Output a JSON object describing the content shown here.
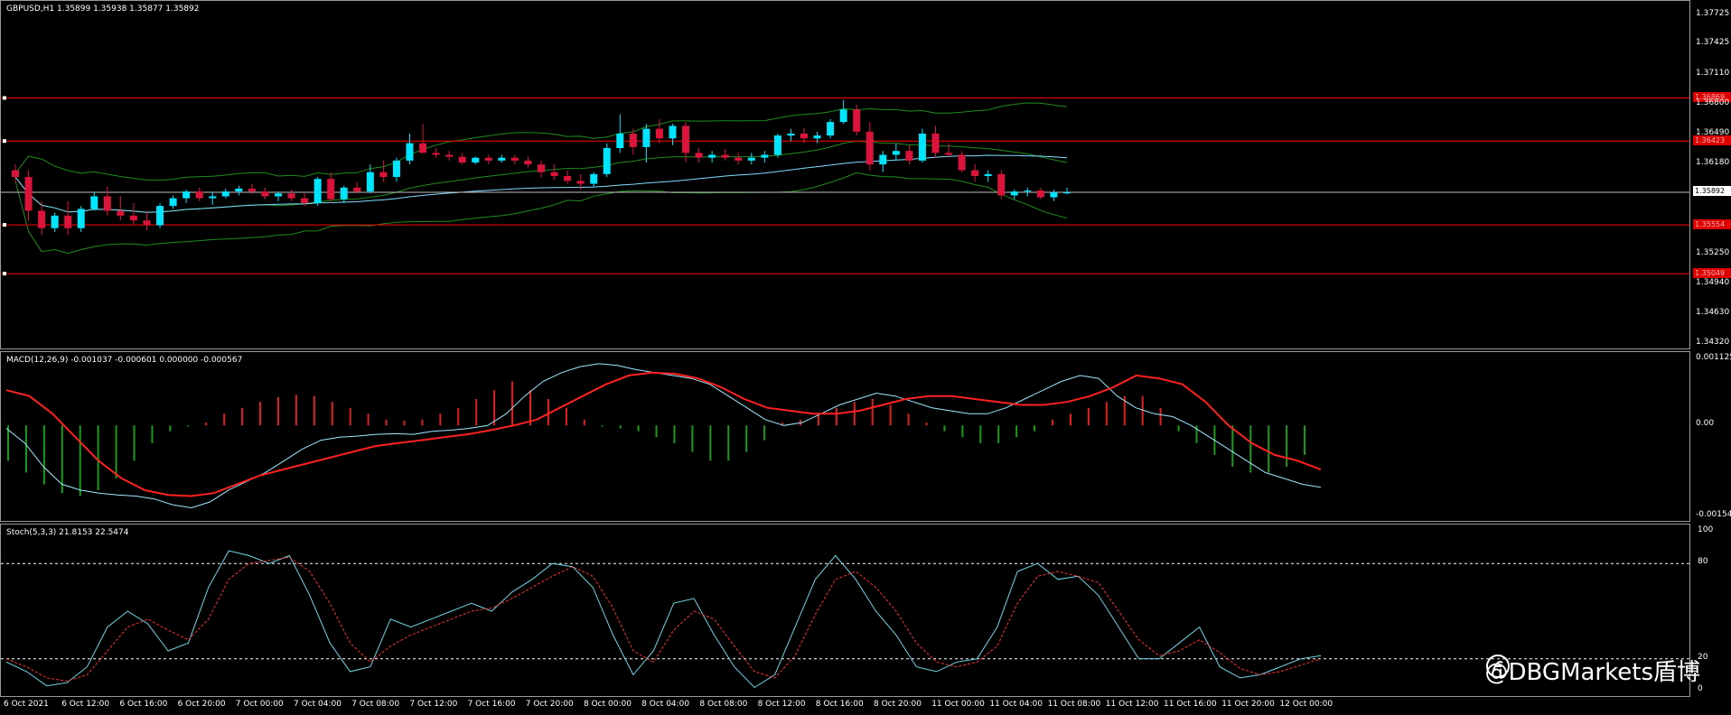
{
  "panels": {
    "price": {
      "title": "GBPUSD,H1  1.35899 1.35938 1.35877 1.35892",
      "yticks": [
        "1.37725",
        "1.37425",
        "1.37110",
        "1.36800",
        "1.36490",
        "1.36180",
        "1.35892",
        "1.35250",
        "1.34940",
        "1.34630",
        "1.34320"
      ],
      "hlines": [
        {
          "label": "1.36869"
        },
        {
          "label": "1.36423"
        },
        {
          "label": "1.35554"
        },
        {
          "label": "1.35049"
        }
      ],
      "current_price": "1.35892"
    },
    "macd": {
      "title": "MACD(12,26,9) -0.001037 -0.000601 0.000000 -0.000567",
      "yticks": [
        "0.001125",
        "0.00",
        "-0.001546"
      ]
    },
    "stoch": {
      "title": "Stoch(5,3,3) 21.8153 22.5474",
      "yticks": [
        "100",
        "80",
        "20",
        "0"
      ]
    }
  },
  "xticks": [
    "6 Oct 2021",
    "6 Oct 12:00",
    "6 Oct 16:00",
    "6 Oct 20:00",
    "7 Oct 00:00",
    "7 Oct 04:00",
    "7 Oct 08:00",
    "7 Oct 12:00",
    "7 Oct 16:00",
    "7 Oct 20:00",
    "8 Oct 00:00",
    "8 Oct 04:00",
    "8 Oct 08:00",
    "8 Oct 12:00",
    "8 Oct 16:00",
    "8 Oct 20:00",
    "11 Oct 00:00",
    "11 Oct 04:00",
    "11 Oct 08:00",
    "11 Oct 12:00",
    "11 Oct 16:00",
    "11 Oct 20:00",
    "12 Oct 00:00"
  ],
  "watermark": "@DBGMarkets盾博",
  "colors": {
    "bull": "#00e5ff",
    "bear": "#dc143c",
    "bands": "#1e8c1e",
    "ma": "#7fdfff",
    "hline": "#ff0000",
    "macd_signal": "#ff2020",
    "hist_pos": "#e02020",
    "hist_neg": "#1a9c1a",
    "stoch_main": "#6fd6e8",
    "stoch_signal": "#ff3030"
  },
  "chart_data": [
    {
      "type": "candlestick",
      "symbol": "GBPUSD",
      "timeframe": "H1",
      "ylim": [
        1.3432,
        1.378
      ],
      "candles": [
        [
          1.3612,
          1.3618,
          1.36,
          1.3605
        ],
        [
          1.3605,
          1.3612,
          1.356,
          1.357
        ],
        [
          1.357,
          1.358,
          1.3545,
          1.3552
        ],
        [
          1.3552,
          1.3568,
          1.3548,
          1.3565
        ],
        [
          1.3565,
          1.358,
          1.3545,
          1.3552
        ],
        [
          1.3552,
          1.3575,
          1.3548,
          1.3572
        ],
        [
          1.3572,
          1.359,
          1.357,
          1.3585
        ],
        [
          1.3585,
          1.3595,
          1.3565,
          1.357
        ],
        [
          1.357,
          1.3585,
          1.356,
          1.3565
        ],
        [
          1.3565,
          1.3578,
          1.3555,
          1.356
        ],
        [
          1.356,
          1.357,
          1.355,
          1.3555
        ],
        [
          1.3555,
          1.3578,
          1.3552,
          1.3575
        ],
        [
          1.3575,
          1.3586,
          1.3572,
          1.3583
        ],
        [
          1.3583,
          1.3592,
          1.3578,
          1.359
        ],
        [
          1.359,
          1.3594,
          1.358,
          1.3583
        ],
        [
          1.3583,
          1.359,
          1.3576,
          1.3585
        ],
        [
          1.3585,
          1.3593,
          1.3583,
          1.359
        ],
        [
          1.359,
          1.3596,
          1.3586,
          1.3593
        ],
        [
          1.3593,
          1.3598,
          1.3587,
          1.359
        ],
        [
          1.359,
          1.3594,
          1.3582,
          1.3585
        ],
        [
          1.3585,
          1.359,
          1.358,
          1.3588
        ],
        [
          1.3588,
          1.3592,
          1.358,
          1.3583
        ],
        [
          1.3583,
          1.3588,
          1.3575,
          1.3578
        ],
        [
          1.3578,
          1.3605,
          1.3575,
          1.3603
        ],
        [
          1.3603,
          1.361,
          1.3578,
          1.3582
        ],
        [
          1.3582,
          1.3596,
          1.3578,
          1.3594
        ],
        [
          1.3594,
          1.36,
          1.3588,
          1.359
        ],
        [
          1.359,
          1.3618,
          1.3588,
          1.361
        ],
        [
          1.361,
          1.3622,
          1.36,
          1.3605
        ],
        [
          1.3605,
          1.3625,
          1.36,
          1.3622
        ],
        [
          1.3622,
          1.365,
          1.3618,
          1.364
        ],
        [
          1.364,
          1.366,
          1.363,
          1.363
        ],
        [
          1.363,
          1.3635,
          1.3625,
          1.3628
        ],
        [
          1.3628,
          1.3632,
          1.3622,
          1.3626
        ],
        [
          1.3626,
          1.363,
          1.3618,
          1.362
        ],
        [
          1.362,
          1.3626,
          1.3618,
          1.3625
        ],
        [
          1.3625,
          1.3628,
          1.3618,
          1.3622
        ],
        [
          1.3622,
          1.3628,
          1.362,
          1.3625
        ],
        [
          1.3625,
          1.3628,
          1.3618,
          1.3622
        ],
        [
          1.3622,
          1.3626,
          1.3615,
          1.3618
        ],
        [
          1.3618,
          1.3622,
          1.3605,
          1.361
        ],
        [
          1.361,
          1.3618,
          1.3602,
          1.3606
        ],
        [
          1.3606,
          1.3612,
          1.3598,
          1.3601
        ],
        [
          1.3601,
          1.3608,
          1.3592,
          1.3598
        ],
        [
          1.3598,
          1.361,
          1.3595,
          1.3608
        ],
        [
          1.3608,
          1.364,
          1.3605,
          1.3635
        ],
        [
          1.3635,
          1.367,
          1.363,
          1.365
        ],
        [
          1.365,
          1.3655,
          1.3628,
          1.3636
        ],
        [
          1.3636,
          1.366,
          1.362,
          1.3655
        ],
        [
          1.3655,
          1.3665,
          1.364,
          1.3645
        ],
        [
          1.3645,
          1.366,
          1.3638,
          1.3658
        ],
        [
          1.3658,
          1.3662,
          1.362,
          1.363
        ],
        [
          1.363,
          1.3635,
          1.362,
          1.3625
        ],
        [
          1.3625,
          1.3632,
          1.362,
          1.3628
        ],
        [
          1.3628,
          1.3634,
          1.3622,
          1.3625
        ],
        [
          1.3625,
          1.363,
          1.3618,
          1.3622
        ],
        [
          1.3622,
          1.363,
          1.3618,
          1.3625
        ],
        [
          1.3625,
          1.3632,
          1.362,
          1.3628
        ],
        [
          1.3628,
          1.365,
          1.3625,
          1.3648
        ],
        [
          1.3648,
          1.3655,
          1.3642,
          1.365
        ],
        [
          1.365,
          1.3656,
          1.364,
          1.3645
        ],
        [
          1.3645,
          1.3652,
          1.364,
          1.3648
        ],
        [
          1.3648,
          1.3665,
          1.3645,
          1.3662
        ],
        [
          1.3662,
          1.3685,
          1.366,
          1.3675
        ],
        [
          1.3675,
          1.368,
          1.3648,
          1.3652
        ],
        [
          1.3652,
          1.3662,
          1.3612,
          1.3618
        ],
        [
          1.3618,
          1.3632,
          1.361,
          1.3628
        ],
        [
          1.3628,
          1.364,
          1.3622,
          1.3632
        ],
        [
          1.3632,
          1.3638,
          1.3618,
          1.3622
        ],
        [
          1.3622,
          1.3655,
          1.362,
          1.365
        ],
        [
          1.365,
          1.3658,
          1.3625,
          1.363
        ],
        [
          1.363,
          1.364,
          1.3625,
          1.3628
        ],
        [
          1.3628,
          1.3632,
          1.361,
          1.3612
        ],
        [
          1.3612,
          1.3618,
          1.36,
          1.3606
        ],
        [
          1.3606,
          1.3612,
          1.36,
          1.3608
        ],
        [
          1.3608,
          1.3612,
          1.3582,
          1.3586
        ],
        [
          1.3586,
          1.3592,
          1.3582,
          1.359
        ],
        [
          1.359,
          1.3594,
          1.3585,
          1.3591
        ],
        [
          1.3591,
          1.3594,
          1.3582,
          1.3584
        ],
        [
          1.3584,
          1.3592,
          1.358,
          1.3589
        ],
        [
          1.3589,
          1.3594,
          1.3587,
          1.3589
        ]
      ]
    },
    {
      "type": "line",
      "name": "MACD(12,26,9)",
      "ylim": [
        -0.001546,
        0.001125
      ],
      "macd_values": [
        -5e-05,
        -0.0003,
        -0.0007,
        -0.001,
        -0.0011,
        -0.00115,
        -0.00118,
        -0.0012,
        -0.00125,
        -0.00135,
        -0.0014,
        -0.0013,
        -0.0011,
        -0.00095,
        -0.0008,
        -0.0006,
        -0.0004,
        -0.00025,
        -0.0002,
        -0.00018,
        -0.00015,
        -0.00014,
        -0.00015,
        -0.0001,
        -8e-05,
        -5e-05,
        0.0,
        0.0002,
        0.0005,
        0.00075,
        0.0009,
        0.001,
        0.00105,
        0.00102,
        0.00095,
        0.0009,
        0.00085,
        0.0008,
        0.0007,
        0.0005,
        0.0003,
        0.0001,
        0.0,
        5e-05,
        0.0002,
        0.00035,
        0.00045,
        0.00055,
        0.0005,
        0.0004,
        0.0003,
        0.00025,
        0.0002,
        0.0002,
        0.0003,
        0.00045,
        0.0006,
        0.00075,
        0.00085,
        0.0008,
        0.0005,
        0.0003,
        0.0002,
        0.00015,
        0.0,
        -0.0002,
        -0.0004,
        -0.0006,
        -0.0008,
        -0.0009,
        -0.001,
        -0.00105
      ],
      "signal_values": [
        0.0006,
        0.0005,
        0.0002,
        -0.0002,
        -0.0006,
        -0.0009,
        -0.0011,
        -0.00118,
        -0.0012,
        -0.00115,
        -0.001,
        -0.00085,
        -0.00075,
        -0.00065,
        -0.00055,
        -0.00045,
        -0.00035,
        -0.0003,
        -0.00025,
        -0.0002,
        -0.00015,
        -8e-05,
        0.0,
        0.0001,
        0.0003,
        0.0005,
        0.0007,
        0.00085,
        0.0009,
        0.00088,
        0.0008,
        0.00065,
        0.00045,
        0.0003,
        0.00025,
        0.0002,
        0.0002,
        0.00025,
        0.00035,
        0.00045,
        0.0005,
        0.0005,
        0.00045,
        0.0004,
        0.00035,
        0.00035,
        0.0004,
        0.0005,
        0.00065,
        0.00085,
        0.0008,
        0.0007,
        0.0004,
        0.0,
        -0.0003,
        -0.0005,
        -0.0006,
        -0.00075
      ],
      "histogram": [
        -0.0006,
        -0.0008,
        -0.001,
        -0.00115,
        -0.0012,
        -0.0011,
        -0.0009,
        -0.0006,
        -0.0003,
        -0.0001,
        -2e-05,
        5e-05,
        0.0002,
        0.0003,
        0.0004,
        0.00048,
        0.00052,
        0.0005,
        0.0004,
        0.0003,
        0.0002,
        0.0001,
        8e-05,
        0.0001,
        0.0002,
        0.0003,
        0.00045,
        0.0006,
        0.00075,
        0.0006,
        0.00045,
        0.0003,
        0.0001,
        -2e-05,
        -5e-05,
        -0.0001,
        -0.0002,
        -0.0003,
        -0.00045,
        -0.0006,
        -0.0006,
        -0.00045,
        -0.00025,
        5e-05,
        0.0001,
        0.0002,
        0.0003,
        0.0004,
        0.00045,
        0.00035,
        0.0002,
        5e-05,
        -0.0001,
        -0.0002,
        -0.0003,
        -0.0003,
        -0.0002,
        -0.0001,
        0.0001,
        0.0002,
        0.0003,
        0.0004,
        0.0005,
        0.0005,
        0.0003,
        -0.0001,
        -0.0003,
        -0.0005,
        -0.0007,
        -0.0008,
        -0.0008,
        -0.0007,
        -0.0005
      ]
    },
    {
      "type": "line",
      "name": "Stoch(5,3,3)",
      "ylim": [
        0,
        100
      ],
      "main": [
        18,
        12,
        3,
        5,
        15,
        40,
        50,
        42,
        25,
        30,
        65,
        88,
        85,
        80,
        85,
        60,
        30,
        12,
        15,
        45,
        40,
        45,
        50,
        55,
        50,
        62,
        70,
        80,
        78,
        65,
        35,
        10,
        25,
        55,
        58,
        35,
        15,
        2,
        10,
        40,
        70,
        85,
        70,
        50,
        35,
        15,
        12,
        18,
        20,
        40,
        75,
        80,
        70,
        72,
        60,
        40,
        20,
        20,
        30,
        40,
        15,
        8,
        10,
        15,
        20,
        22
      ],
      "signal": [
        20,
        15,
        8,
        6,
        10,
        25,
        40,
        45,
        38,
        32,
        45,
        70,
        80,
        82,
        84,
        75,
        55,
        30,
        18,
        28,
        35,
        40,
        45,
        50,
        52,
        58,
        65,
        72,
        78,
        72,
        52,
        25,
        18,
        38,
        50,
        45,
        28,
        12,
        8,
        22,
        48,
        70,
        75,
        65,
        50,
        30,
        18,
        15,
        18,
        28,
        55,
        72,
        75,
        72,
        68,
        50,
        32,
        22,
        25,
        32,
        24,
        14,
        10,
        12,
        16,
        20
      ]
    }
  ]
}
